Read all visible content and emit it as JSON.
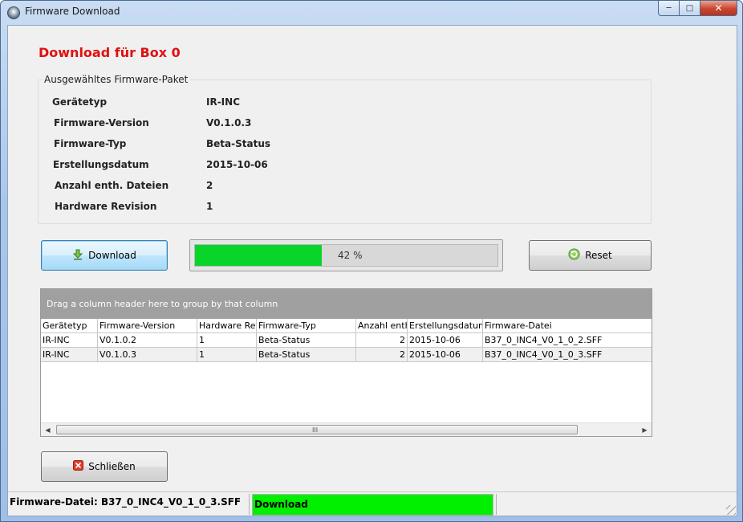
{
  "window": {
    "title": "Firmware Download",
    "min": "─",
    "max": "□",
    "close": "✕"
  },
  "heading": "Download für Box 0",
  "package": {
    "title": "Ausgewähltes Firmware-Paket",
    "rows": [
      {
        "label": "Gerätetyp",
        "value": "IR-INC"
      },
      {
        "label": "Firmware-Version",
        "value": "V0.1.0.3"
      },
      {
        "label": "Firmware-Typ",
        "value": "Beta-Status"
      },
      {
        "label": "Erstellungsdatum",
        "value": "2015-10-06"
      },
      {
        "label": "Anzahl enth. Dateien",
        "value": "2"
      },
      {
        "label": "Hardware Revision",
        "value": "1"
      }
    ]
  },
  "buttons": {
    "download": "Download",
    "reset": "Reset",
    "close": "Schließen"
  },
  "progress": {
    "text": "42 %",
    "fraction": 0.42,
    "color": "#09d42a"
  },
  "grid": {
    "group_hint": "Drag a column header here to group by that column",
    "columns": [
      "Gerätetyp",
      "Firmware-Version",
      "Hardware Rev",
      "Firmware-Typ",
      "Anzahl enth",
      "Erstellungsdatum",
      "Firmware-Datei"
    ],
    "rows": [
      [
        "IR-INC",
        "V0.1.0.2",
        "1",
        "Beta-Status",
        "2",
        "2015-10-06",
        "B37_0_INC4_V0_1_0_2.SFF"
      ],
      [
        "IR-INC",
        "V0.1.0.3",
        "1",
        "Beta-Status",
        "2",
        "2015-10-06",
        "B37_0_INC4_V0_1_0_3.SFF"
      ]
    ],
    "scroll_left": "◀",
    "scroll_right": "▶",
    "scroll_grip": "III"
  },
  "statusbar": {
    "file": "Firmware-Datei: B37_0_INC4_V0_1_0_3.SFF",
    "state": "Download",
    "state_color": "#00f000"
  },
  "colors": {
    "heading": "#e01010",
    "accent_green": "#09d42a"
  }
}
